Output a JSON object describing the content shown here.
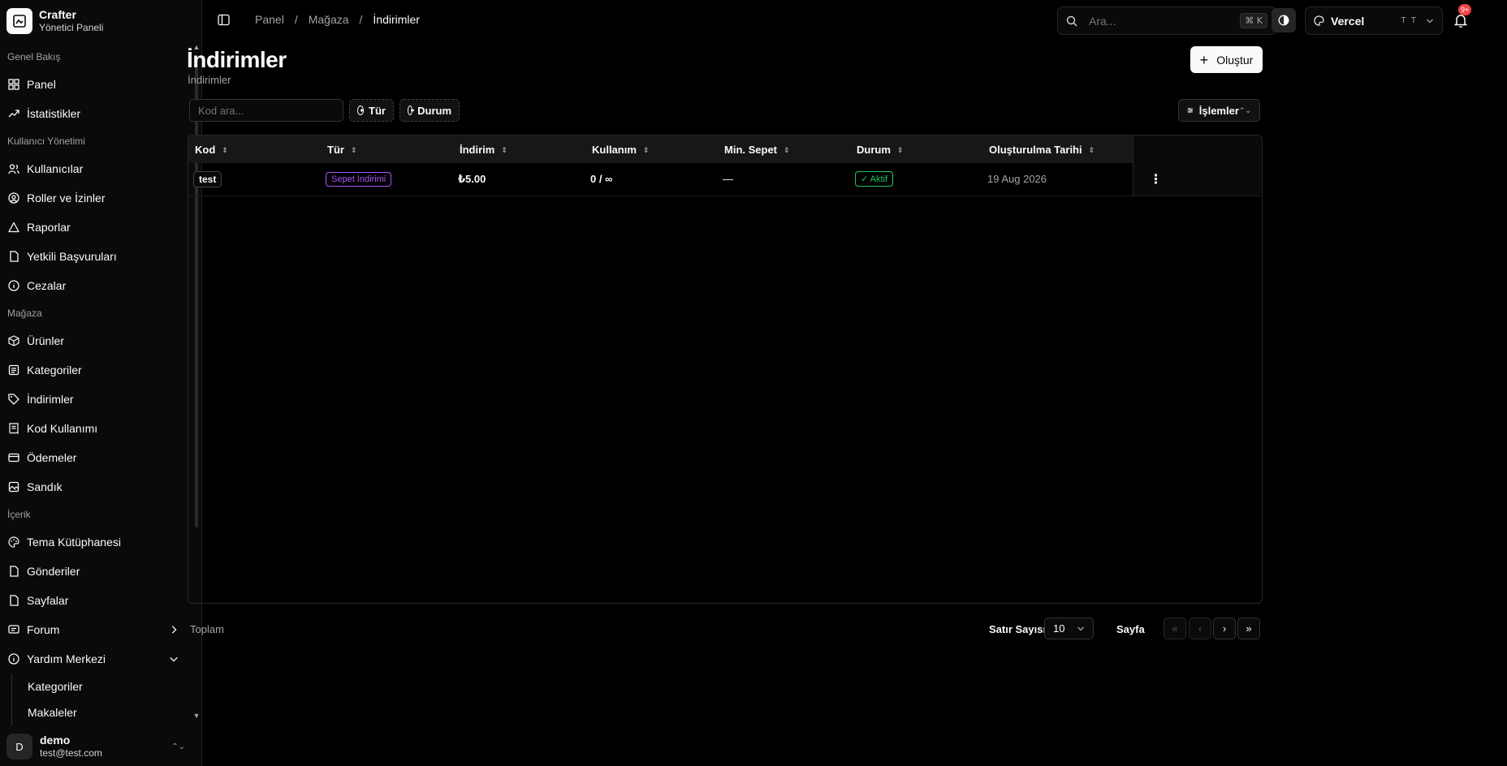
{
  "brand": {
    "name": "Crafter",
    "subtitle": "Yönetici Paneli"
  },
  "sidebar": {
    "groups": [
      {
        "label": "Genel Bakış",
        "items": [
          {
            "label": "Panel",
            "icon": "dashboard-icon"
          },
          {
            "label": "İstatistikler",
            "icon": "trending-icon"
          }
        ]
      },
      {
        "label": "Kullanıcı Yönetimi",
        "items": [
          {
            "label": "Kullanıcılar",
            "icon": "users-icon"
          },
          {
            "label": "Roller ve İzinler",
            "icon": "user-circle-icon"
          },
          {
            "label": "Raporlar",
            "icon": "alert-triangle-icon"
          },
          {
            "label": "Yetkili Başvuruları",
            "icon": "file-icon"
          },
          {
            "label": "Cezalar",
            "icon": "info-icon"
          }
        ]
      },
      {
        "label": "Mağaza",
        "items": [
          {
            "label": "Ürünler",
            "icon": "box-icon"
          },
          {
            "label": "Kategoriler",
            "icon": "list-icon"
          },
          {
            "label": "İndirimler",
            "icon": "tag-icon"
          },
          {
            "label": "Kod Kullanımı",
            "icon": "receipt-icon"
          },
          {
            "label": "Ödemeler",
            "icon": "wallet-icon"
          },
          {
            "label": "Sandık",
            "icon": "image-icon"
          }
        ]
      },
      {
        "label": "İçerik",
        "items": [
          {
            "label": "Tema Kütüphanesi",
            "icon": "palette-icon"
          },
          {
            "label": "Gönderiler",
            "icon": "file-icon"
          },
          {
            "label": "Sayfalar",
            "icon": "file-icon"
          },
          {
            "label": "Forum",
            "icon": "message-icon"
          },
          {
            "label": "Yardım Merkezi",
            "icon": "info-icon"
          }
        ]
      }
    ],
    "help_sub": [
      "Kategoriler",
      "Makaleler"
    ]
  },
  "user": {
    "initial": "D",
    "name": "demo",
    "email": "test@test.com"
  },
  "breadcrumb": [
    "Panel",
    "Mağaza",
    "İndirimler"
  ],
  "search": {
    "placeholder": "Ara...",
    "shortcut": "⌘ K"
  },
  "theme": {
    "name": "Vercel",
    "shortcut": "T T"
  },
  "notifications": {
    "badge": "9+"
  },
  "page": {
    "title": "İndirimler",
    "subtitle": "İndirimler",
    "create_label": "Oluştur"
  },
  "filters": {
    "code_placeholder": "Kod ara...",
    "type_label": "Tür",
    "status_label": "Durum",
    "actions_label": "İşlemler"
  },
  "table": {
    "columns": [
      "Kod",
      "Tür",
      "İndirim",
      "Kullanım",
      "Min. Sepet",
      "Durum",
      "Oluşturulma Tarihi"
    ],
    "rows": [
      {
        "code": "test",
        "type": "Sepet İndirimi",
        "discount": "₺5.00",
        "usage": "0 / ∞",
        "min_cart": "—",
        "status": "✓ Aktif",
        "created": "19 Aug 2026"
      }
    ]
  },
  "footer": {
    "total_label": "Toplam",
    "rows_label": "Satır Sayısı",
    "rows_value": "10",
    "page_label": "Sayfa"
  },
  "colors": {
    "accent_purple": "#a855f7",
    "status_green": "#22c55e",
    "badge_red": "#ef4444"
  }
}
